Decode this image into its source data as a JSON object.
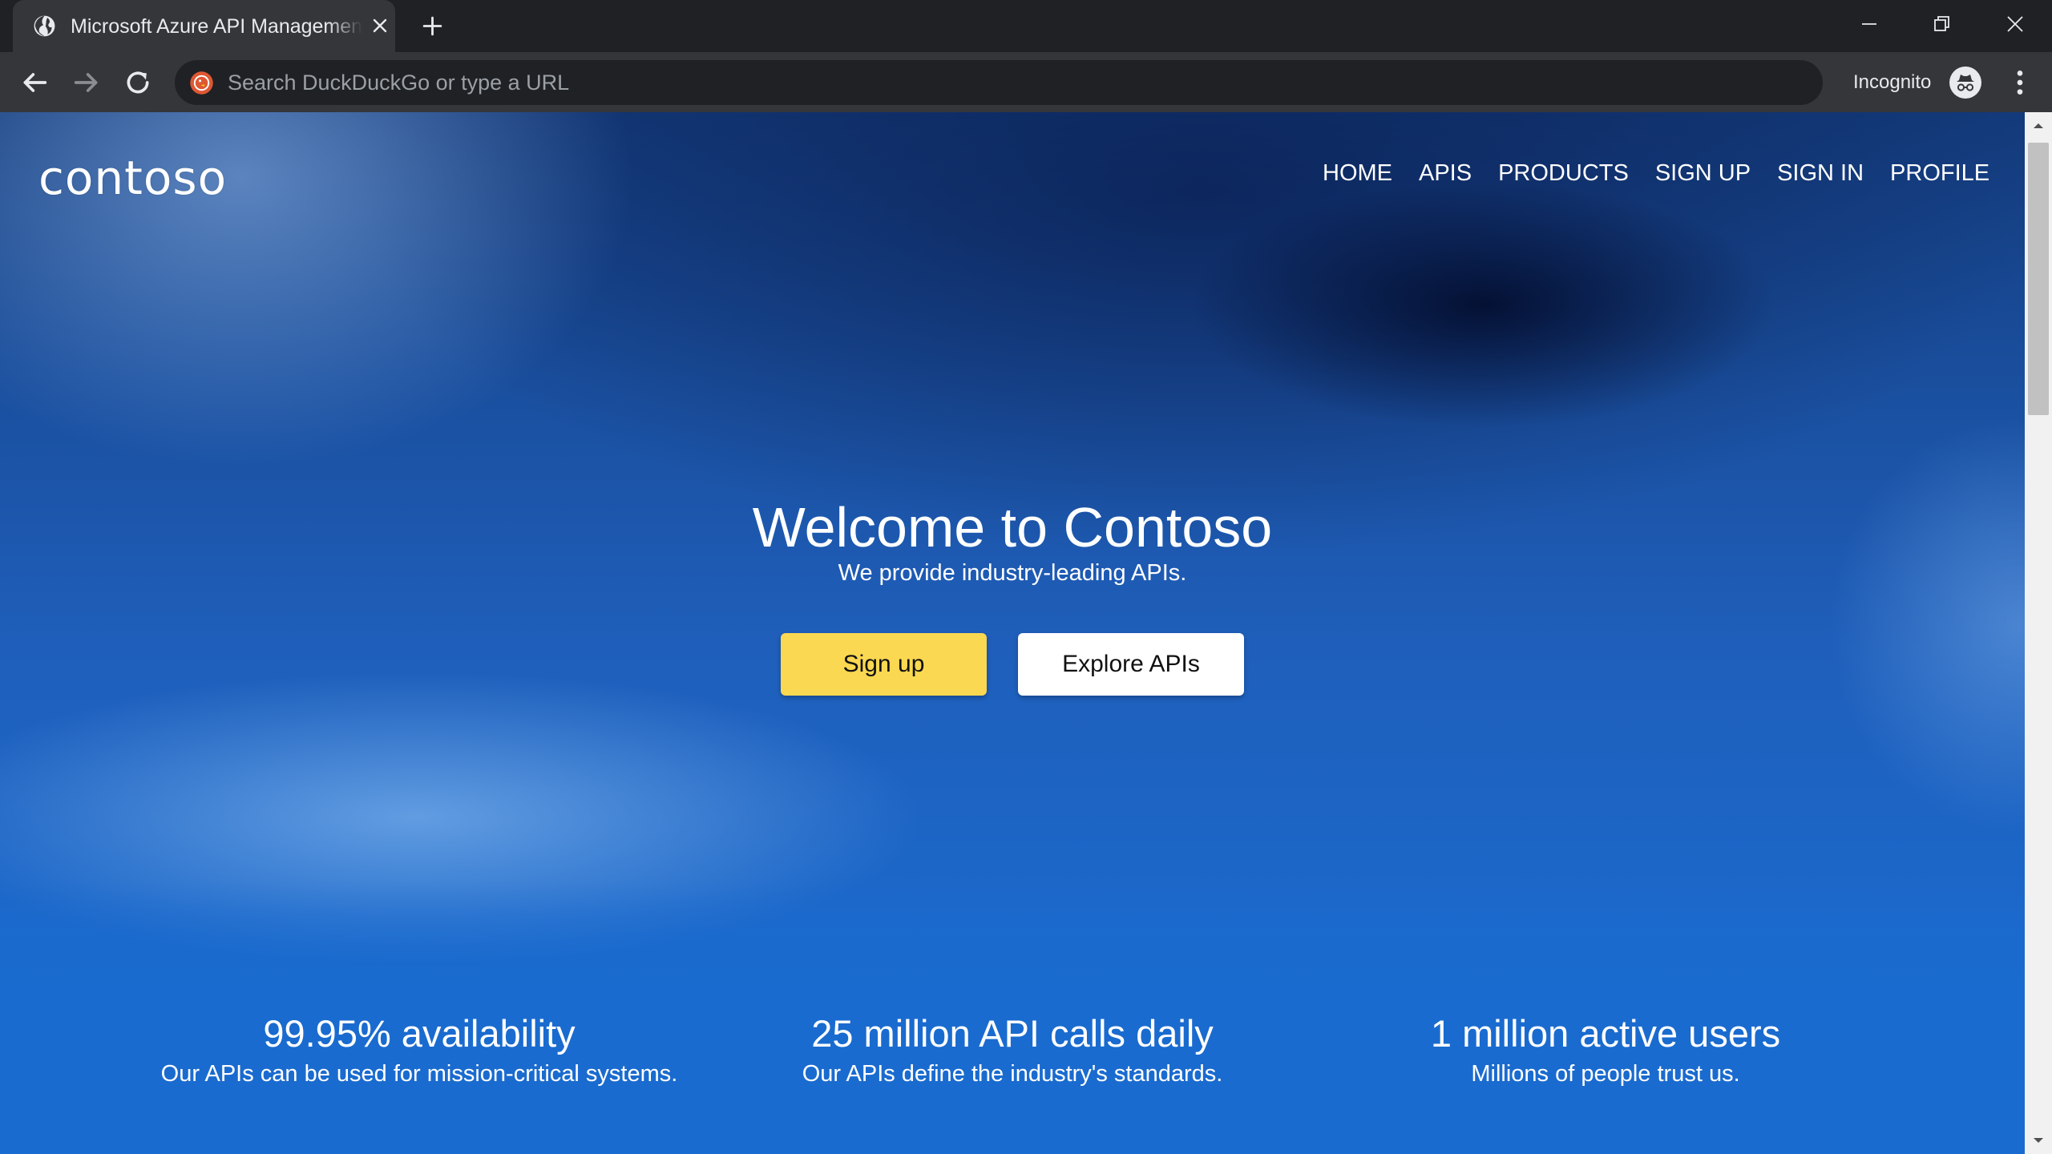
{
  "browser": {
    "tab_title": "Microsoft Azure API Management",
    "omnibox_placeholder": "Search DuckDuckGo or type a URL",
    "incognito_label": "Incognito"
  },
  "site": {
    "logo": "contoso",
    "nav": [
      "HOME",
      "APIS",
      "PRODUCTS",
      "SIGN UP",
      "SIGN IN",
      "PROFILE"
    ],
    "hero": {
      "title": "Welcome to Contoso",
      "subtitle": "We provide industry-leading APIs.",
      "primary_button": "Sign up",
      "secondary_button": "Explore APIs"
    },
    "stats": [
      {
        "title": "99.95% availability",
        "description": "Our APIs can be used for mission-critical systems."
      },
      {
        "title": "25 million API calls daily",
        "description": "Our APIs define the industry's standards."
      },
      {
        "title": "1 million active users",
        "description": "Millions of people trust us."
      }
    ]
  },
  "colors": {
    "chrome_dark": "#202124",
    "chrome_toolbar": "#35363a",
    "hero_blue": "#1a6bcf",
    "signup_yellow": "#fbd851"
  },
  "icons": [
    "globe-icon",
    "close-icon",
    "plus-icon",
    "minimize-icon",
    "restore-icon",
    "back-arrow-icon",
    "forward-arrow-icon",
    "reload-icon",
    "duckduckgo-icon",
    "incognito-icon",
    "kebab-menu-icon",
    "chevron-up-icon",
    "chevron-down-icon"
  ]
}
